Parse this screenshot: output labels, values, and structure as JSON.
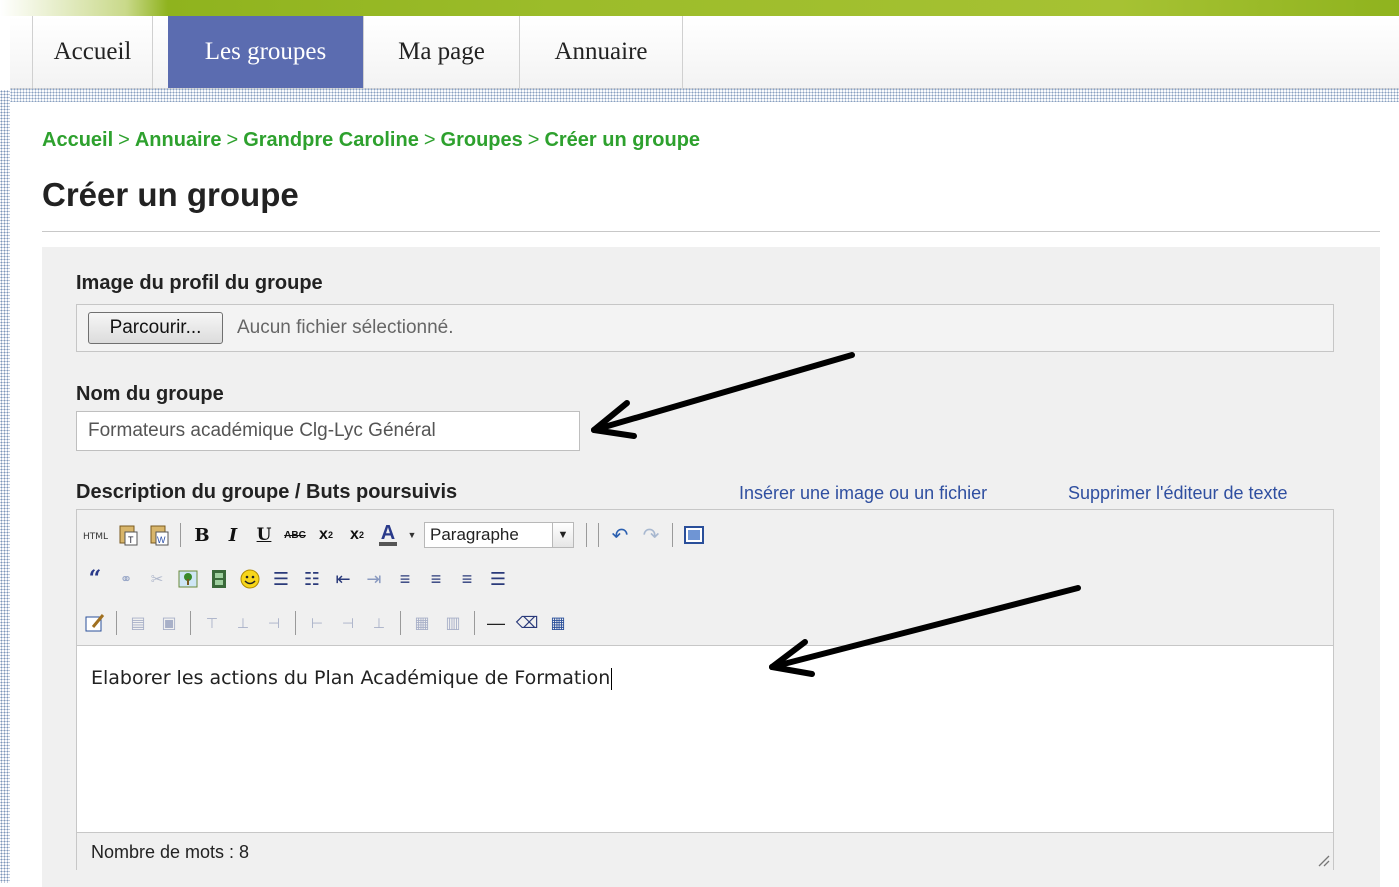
{
  "nav": {
    "tabs": [
      {
        "label": "Accueil",
        "active": false
      },
      {
        "label": "Les groupes",
        "active": true
      },
      {
        "label": "Ma page",
        "active": false
      },
      {
        "label": "Annuaire",
        "active": false
      }
    ]
  },
  "breadcrumb": [
    "Accueil",
    "Annuaire",
    "Grandpre Caroline",
    "Groupes",
    "Créer un groupe"
  ],
  "breadcrumb_separator": ">",
  "page_title": "Créer un groupe",
  "form": {
    "profile_image_label": "Image du profil du groupe",
    "browse_button": "Parcourir...",
    "no_file_text": "Aucun fichier sélectionné.",
    "group_name_label": "Nom du groupe",
    "group_name_value": "Formateurs académique Clg-Lyc Général",
    "description_label": "Description du groupe / Buts poursuivis",
    "insert_media_link": "Insérer une image ou un fichier",
    "remove_editor_link": "Supprimer l'éditeur de texte"
  },
  "editor": {
    "format_select": "Paragraphe",
    "content": "Elaborer les actions du Plan Académique de Formation",
    "word_count": "Nombre de mots : 8"
  },
  "colors": {
    "accent_green": "#2ea12e",
    "active_tab": "#5b6cb0",
    "link_blue": "#2f4fa0"
  }
}
